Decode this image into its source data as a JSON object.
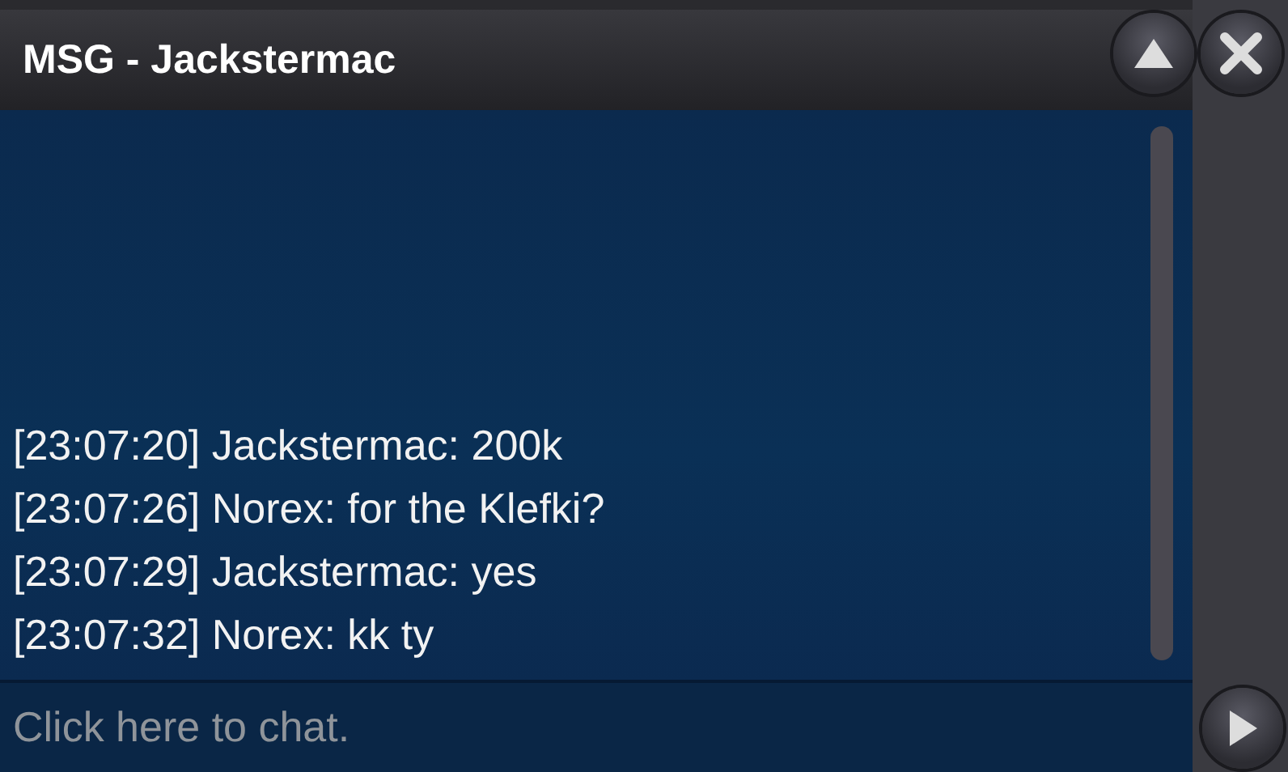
{
  "window": {
    "title": "MSG - Jackstermac"
  },
  "messages": [
    {
      "line": "[23:07:20] Jackstermac: 200k"
    },
    {
      "line": "[23:07:26] Norex: for the Klefki?"
    },
    {
      "line": "[23:07:29] Jackstermac: yes"
    },
    {
      "line": "[23:07:32] Norex: kk ty"
    }
  ],
  "chat_input": {
    "placeholder": "Click here to chat."
  }
}
